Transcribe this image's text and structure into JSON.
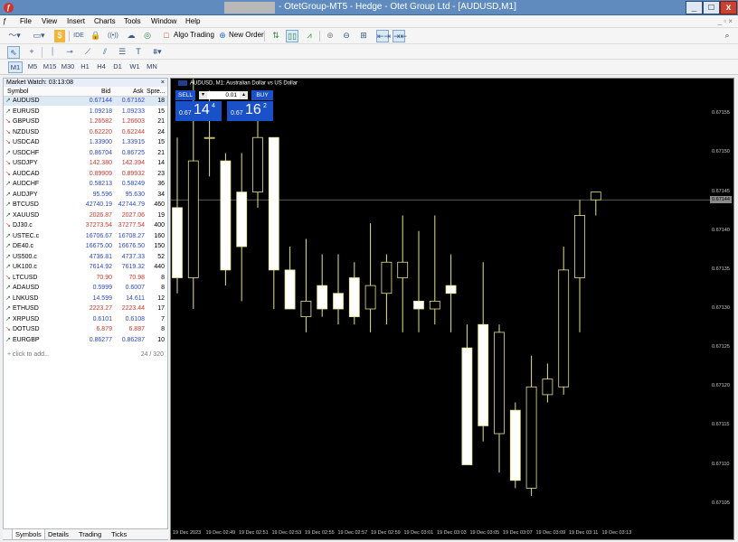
{
  "window": {
    "title": "- OtetGroup-MT5 - Hedge - Otet Group Ltd - [AUDUSD,M1]",
    "app_icon": "metatrader-icon",
    "controls": {
      "minimize": "_",
      "maximize": "□",
      "close": "x"
    }
  },
  "menu": {
    "items": [
      "File",
      "View",
      "Insert",
      "Charts",
      "Tools",
      "Window",
      "Help"
    ],
    "child_controls": "_ ▫ ×"
  },
  "toolbar": {
    "algo_trading": "Algo Trading",
    "new_order": "New Order",
    "search_icon": "search-icon"
  },
  "timeframes": [
    "M1",
    "M5",
    "M15",
    "M30",
    "H1",
    "H4",
    "D1",
    "W1",
    "MN"
  ],
  "selected_timeframe": "M1",
  "market_watch": {
    "title": "Market Watch: 03:13:08",
    "close": "×",
    "columns": [
      "Symbol",
      "Bid",
      "Ask",
      "Spre..."
    ],
    "rows": [
      {
        "dir": "up",
        "symbol": "AUDUSD",
        "bid": "0.67144",
        "ask": "0.67162",
        "spread": "18",
        "color": "up"
      },
      {
        "dir": "up",
        "symbol": "EURUSD",
        "bid": "1.09218",
        "ask": "1.09233",
        "spread": "15",
        "color": "up"
      },
      {
        "dir": "dn",
        "symbol": "GBPUSD",
        "bid": "1.26582",
        "ask": "1.26603",
        "spread": "21",
        "color": "dn"
      },
      {
        "dir": "dn",
        "symbol": "NZDUSD",
        "bid": "0.62220",
        "ask": "0.62244",
        "spread": "24",
        "color": "dn"
      },
      {
        "dir": "dn",
        "symbol": "USDCAD",
        "bid": "1.33900",
        "ask": "1.33915",
        "spread": "15",
        "color": "up"
      },
      {
        "dir": "up",
        "symbol": "USDCHF",
        "bid": "0.86704",
        "ask": "0.86725",
        "spread": "21",
        "color": "up"
      },
      {
        "dir": "dn",
        "symbol": "USDJPY",
        "bid": "142.380",
        "ask": "142.394",
        "spread": "14",
        "color": "dn"
      },
      {
        "dir": "dn",
        "symbol": "AUDCAD",
        "bid": "0.89909",
        "ask": "0.89932",
        "spread": "23",
        "color": "dn"
      },
      {
        "dir": "up",
        "symbol": "AUDCHF",
        "bid": "0.58213",
        "ask": "0.58249",
        "spread": "36",
        "color": "up"
      },
      {
        "dir": "up",
        "symbol": "AUDJPY",
        "bid": "95.596",
        "ask": "95.630",
        "spread": "34",
        "color": "up"
      },
      {
        "dir": "up",
        "symbol": "BTCUSD",
        "bid": "42740.19",
        "ask": "42744.79",
        "spread": "460",
        "color": "up"
      },
      {
        "dir": "up",
        "symbol": "XAUUSD",
        "bid": "2026.87",
        "ask": "2027.06",
        "spread": "19",
        "color": "dn"
      },
      {
        "dir": "dn",
        "symbol": "DJ30.c",
        "bid": "37273.54",
        "ask": "37277.54",
        "spread": "400",
        "color": "dn"
      },
      {
        "dir": "up",
        "symbol": "USTEC.c",
        "bid": "16706.67",
        "ask": "16708.27",
        "spread": "160",
        "color": "up"
      },
      {
        "dir": "up",
        "symbol": "DE40.c",
        "bid": "16675.00",
        "ask": "16676.50",
        "spread": "150",
        "color": "up"
      },
      {
        "dir": "up",
        "symbol": "US500.c",
        "bid": "4736.81",
        "ask": "4737.33",
        "spread": "52",
        "color": "up"
      },
      {
        "dir": "up",
        "symbol": "UK100.c",
        "bid": "7614.92",
        "ask": "7619.32",
        "spread": "440",
        "color": "up"
      },
      {
        "dir": "dn",
        "symbol": "LTCUSD",
        "bid": "70.90",
        "ask": "70.98",
        "spread": "8",
        "color": "dn"
      },
      {
        "dir": "up",
        "symbol": "ADAUSD",
        "bid": "0.5999",
        "ask": "0.6007",
        "spread": "8",
        "color": "up"
      },
      {
        "dir": "up",
        "symbol": "LNKUSD",
        "bid": "14.599",
        "ask": "14.611",
        "spread": "12",
        "color": "up"
      },
      {
        "dir": "up",
        "symbol": "ETHUSD",
        "bid": "2223.27",
        "ask": "2223.44",
        "spread": "17",
        "color": "dn"
      },
      {
        "dir": "up",
        "symbol": "XRPUSD",
        "bid": "0.6101",
        "ask": "0.6108",
        "spread": "7",
        "color": "up"
      },
      {
        "dir": "dn",
        "symbol": "DOTUSD",
        "bid": "6.879",
        "ask": "6.887",
        "spread": "8",
        "color": "dn"
      },
      {
        "dir": "up",
        "symbol": "EURGBP",
        "bid": "0.86277",
        "ask": "0.86287",
        "spread": "10",
        "color": "up"
      }
    ],
    "add_placeholder": "click to add...",
    "count": "24 / 320",
    "tabs": [
      "Symbols",
      "Details",
      "Trading",
      "Ticks"
    ]
  },
  "trade_panel": {
    "sell_label": "SELL",
    "buy_label": "BUY",
    "volume": "0.01",
    "sell_price": {
      "pre": "0.67",
      "big": "14",
      "sup": "4"
    },
    "buy_price": {
      "pre": "0.67",
      "big": "16",
      "sup": "2"
    }
  },
  "chart_data": {
    "type": "candlestick",
    "title": "AUDUSD, M1:  Australian Dollar vs US Dollar",
    "current_price": "0.67144",
    "y_ticks": [
      "0.67155",
      "0.67150",
      "0.67145",
      "0.67140",
      "0.67135",
      "0.67130",
      "0.67125",
      "0.67120",
      "0.67115",
      "0.67110",
      "0.67105"
    ],
    "ylim": [
      0.671016,
      0.671584
    ],
    "x_labels": [
      "19 Dec 2023",
      "19 Dec 02:49",
      "19 Dec 02:51",
      "19 Dec 02:53",
      "19 Dec 02:55",
      "19 Dec 02:57",
      "19 Dec 02:59",
      "19 Dec 03:01",
      "19 Dec 03:03",
      "19 Dec 03:05",
      "19 Dec 03:07",
      "19 Dec 03:09",
      "19 Dec 03:11",
      "19 Dec 03:13"
    ],
    "candles": [
      {
        "o": 0.67143,
        "h": 0.67152,
        "l": 0.67132,
        "c": 0.67134
      },
      {
        "o": 0.67134,
        "h": 0.6716,
        "l": 0.6713,
        "c": 0.67149
      },
      {
        "o": 0.67152,
        "h": 0.67158,
        "l": 0.67147,
        "c": 0.67152
      },
      {
        "o": 0.67149,
        "h": 0.6715,
        "l": 0.67133,
        "c": 0.67135
      },
      {
        "o": 0.67145,
        "h": 0.6715,
        "l": 0.67131,
        "c": 0.67138
      },
      {
        "o": 0.67145,
        "h": 0.67155,
        "l": 0.67143,
        "c": 0.67152
      },
      {
        "o": 0.67152,
        "h": 0.67152,
        "l": 0.6713,
        "c": 0.67135
      },
      {
        "o": 0.67135,
        "h": 0.67138,
        "l": 0.6713,
        "c": 0.6713
      },
      {
        "o": 0.67129,
        "h": 0.67139,
        "l": 0.67127,
        "c": 0.67131
      },
      {
        "o": 0.67133,
        "h": 0.67137,
        "l": 0.67129,
        "c": 0.6713
      },
      {
        "o": 0.67132,
        "h": 0.67137,
        "l": 0.67128,
        "c": 0.6713
      },
      {
        "o": 0.67134,
        "h": 0.67136,
        "l": 0.67128,
        "c": 0.67129
      },
      {
        "o": 0.6713,
        "h": 0.67141,
        "l": 0.67127,
        "c": 0.67133
      },
      {
        "o": 0.67132,
        "h": 0.67137,
        "l": 0.67128,
        "c": 0.67136
      },
      {
        "o": 0.67134,
        "h": 0.67142,
        "l": 0.67127,
        "c": 0.67136
      },
      {
        "o": 0.67131,
        "h": 0.6714,
        "l": 0.67127,
        "c": 0.6713
      },
      {
        "o": 0.6713,
        "h": 0.67142,
        "l": 0.67128,
        "c": 0.67131
      },
      {
        "o": 0.67133,
        "h": 0.67137,
        "l": 0.67127,
        "c": 0.67132
      },
      {
        "o": 0.67125,
        "h": 0.67128,
        "l": 0.67114,
        "c": 0.6711
      },
      {
        "o": 0.67128,
        "h": 0.67136,
        "l": 0.67113,
        "c": 0.67115
      },
      {
        "o": 0.67114,
        "h": 0.67128,
        "l": 0.67109,
        "c": 0.67127
      },
      {
        "o": 0.67117,
        "h": 0.67118,
        "l": 0.67107,
        "c": 0.67108
      },
      {
        "o": 0.67107,
        "h": 0.67124,
        "l": 0.67106,
        "c": 0.6712
      },
      {
        "o": 0.67119,
        "h": 0.67123,
        "l": 0.67118,
        "c": 0.67121
      },
      {
        "o": 0.6712,
        "h": 0.67138,
        "l": 0.67119,
        "c": 0.67135
      },
      {
        "o": 0.67134,
        "h": 0.67144,
        "l": 0.67127,
        "c": 0.67142
      },
      {
        "o": 0.67144,
        "h": 0.67145,
        "l": 0.67142,
        "c": 0.67145
      }
    ]
  }
}
